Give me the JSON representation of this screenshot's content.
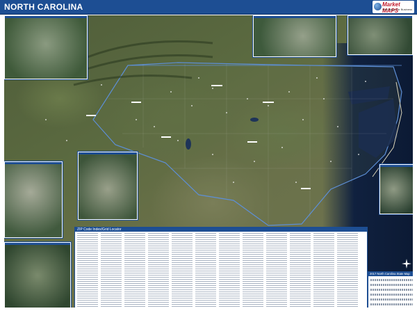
{
  "header": {
    "title": "NORTH CAROLINA",
    "logo_text": "Market MAPS",
    "logo_subtext": "Wall Maps For Business"
  },
  "zip_locator": {
    "title": "ZIP Code Index/Grid Locator"
  },
  "legend": {
    "title": "2017 North Carolina State Map"
  },
  "colors": {
    "title_bar": "#1d4e93",
    "ocean": "#10213f",
    "state_border": "#5d8fd6"
  }
}
